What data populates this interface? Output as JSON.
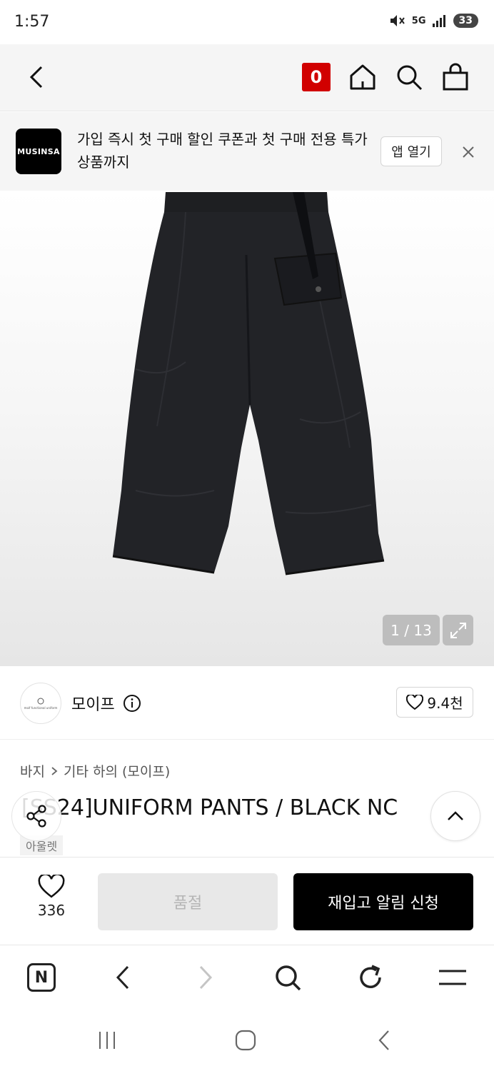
{
  "status_bar": {
    "time": "1:57",
    "network": "5G",
    "battery": "33"
  },
  "header": {
    "cart_count": "0"
  },
  "promo": {
    "logo": "MUSINSA",
    "message": "가입 즉시 첫 구매 할인 쿠폰과 첫 구매 전용 특가 상품까지",
    "open_app_label": "앱 열기"
  },
  "gallery": {
    "counter": "1 / 13"
  },
  "brand": {
    "name": "모이프",
    "avatar_text": "moif functional uniform",
    "likes": "9.4천"
  },
  "product": {
    "breadcrumb": [
      "바지",
      "기타 하의 (모이프)"
    ],
    "title": "[SS24]UNIFORM PANTS / BLACK NC",
    "tag": "아울렛"
  },
  "purchase": {
    "wish_count": "336",
    "soldout_label": "품절",
    "restock_label": "재입고 알림 신청"
  },
  "colors": {
    "accent_red": "#d10000",
    "black": "#000000"
  }
}
